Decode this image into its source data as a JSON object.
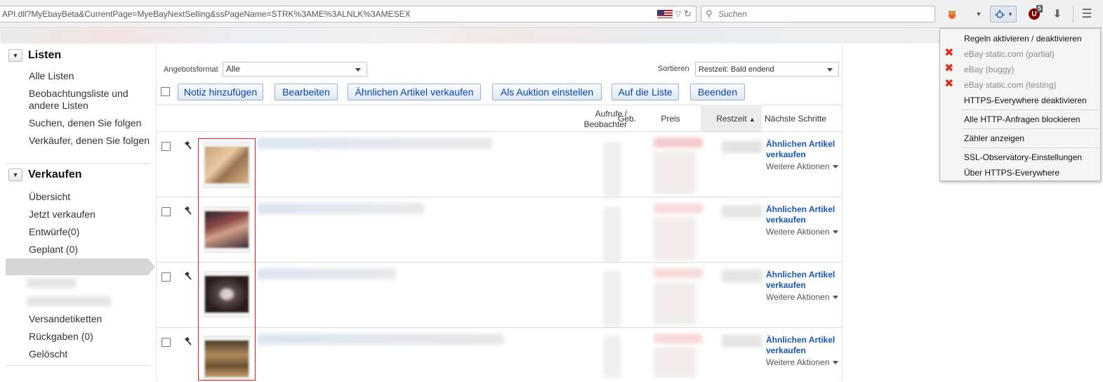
{
  "browser": {
    "url": "API.dll?MyEbayBeta&CurrentPage=MyeBayNextSelling&ssPageName=STRK%3AME%3ALNLK%3AMESEX",
    "search_placeholder": "Suchen",
    "ublock_count": "5",
    "ublock_letter": "U"
  },
  "sidebar": {
    "listen_heading": "Listen",
    "listen_items": [
      "Alle Listen",
      "Beobachtungsliste und andere Listen",
      "Suchen, denen Sie folgen",
      "Verkäufer, denen Sie folgen"
    ],
    "verkaufen_heading": "Verkaufen",
    "verkaufen_items": [
      "Übersicht",
      "Jetzt verkaufen",
      "Entwürfe(0)",
      "Geplant (0)"
    ],
    "verkaufen_items_bottom": [
      "Versandetiketten",
      "Rückgaben (0)",
      "Gelöscht"
    ]
  },
  "filters": {
    "format_label": "Angebotsformat",
    "format_value": "Alle",
    "sort_label": "Sortieren",
    "sort_value": "Restzeit: Bald endend"
  },
  "actions": {
    "note": "Notiz hinzufügen",
    "edit": "Bearbeiten",
    "sell_similar": "Ähnlichen Artikel verkaufen",
    "as_auction": "Als Auktion einstellen",
    "to_list": "Auf die Liste",
    "end": "Beenden"
  },
  "columns": {
    "views_line1": "Aufrufe /",
    "views_line2": "Beobachter",
    "bids": "Geb.",
    "price": "Preis",
    "time_left": "Restzeit",
    "next_steps": "Nächste Schritte"
  },
  "rows": [
    {
      "next_line1": "Ähnlichen Artikel",
      "next_line2": "verkaufen",
      "more": "Weitere Aktionen"
    },
    {
      "next_line1": "Ähnlichen Artikel",
      "next_line2": "verkaufen",
      "more": "Weitere Aktionen"
    },
    {
      "next_line1": "Ähnlichen Artikel",
      "next_line2": "verkaufen",
      "more": "Weitere Aktionen"
    },
    {
      "next_line1": "Ähnlichen Artikel",
      "next_line2": "verkaufen",
      "more": "Weitere Aktionen"
    }
  ],
  "https_menu": {
    "toggle_rules": "Regeln aktivieren / deaktivieren",
    "rules": [
      "eBay static.com (partial)",
      "eBay (buggy)",
      "eBay static.com (testing)"
    ],
    "disable": "HTTPS-Everywhere deaktivieren",
    "block_http": "Alle HTTP-Anfragen blockieren",
    "show_counter": "Zähler anzeigen",
    "ssl_settings": "SSL-Observatory-Einstellungen",
    "about": "Über HTTPS-Everywhere"
  },
  "colors": {
    "link": "#1a56b8",
    "highlight_box": "#e02020",
    "disabled_rule_icon": "#d6301f"
  }
}
